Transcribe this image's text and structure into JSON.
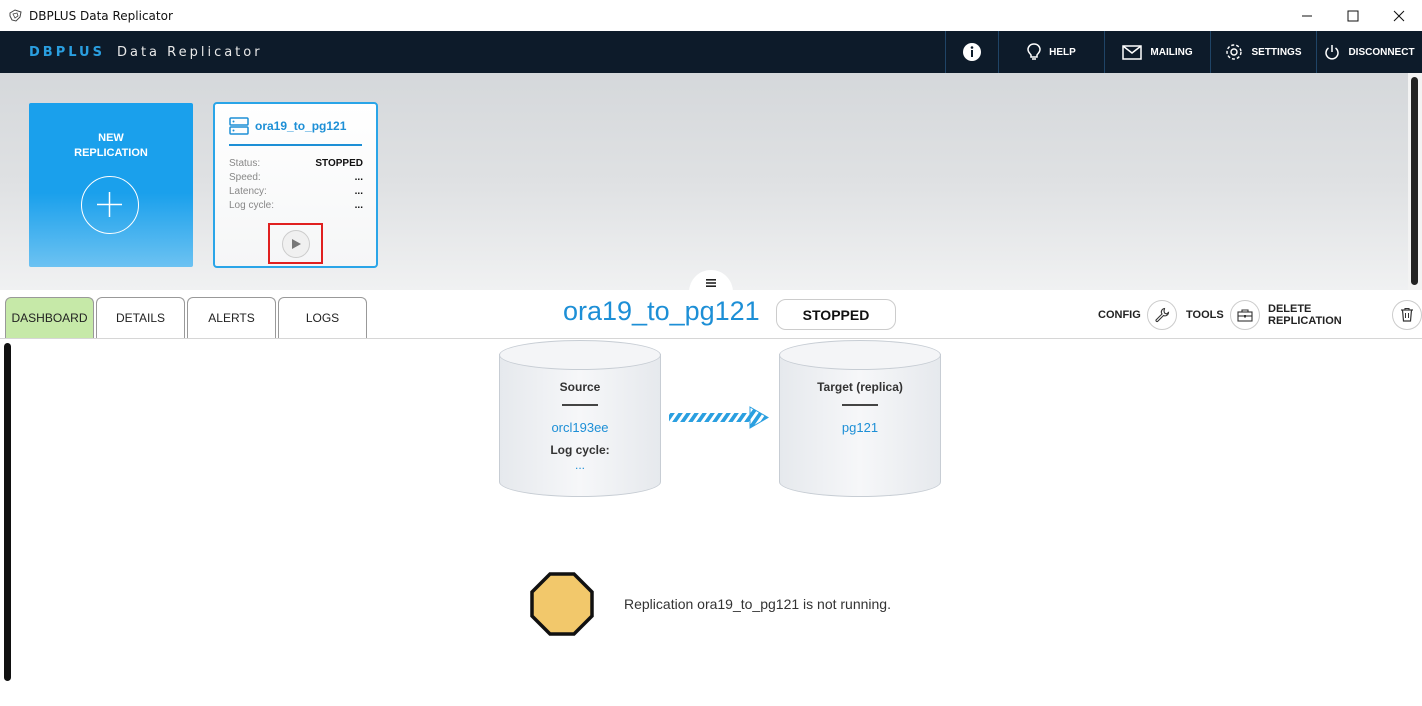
{
  "window": {
    "title": "DBPLUS Data Replicator"
  },
  "header": {
    "brand_primary": "DBPLUS",
    "brand_secondary": "Data Replicator",
    "nav": {
      "help": "HELP",
      "mailing": "MAILING",
      "settings": "SETTINGS",
      "disconnect": "DISCONNECT"
    }
  },
  "new_replication": {
    "line1": "NEW",
    "line2": "REPLICATION"
  },
  "replication_card": {
    "name": "ora19_to_pg121",
    "rows": [
      {
        "label": "Status:",
        "value": "STOPPED"
      },
      {
        "label": "Speed:",
        "value": "..."
      },
      {
        "label": "Latency:",
        "value": "..."
      },
      {
        "label": "Log cycle:",
        "value": "..."
      }
    ]
  },
  "tabs": [
    "DASHBOARD",
    "DETAILS",
    "ALERTS",
    "LOGS"
  ],
  "main": {
    "replication_name": "ora19_to_pg121",
    "status": "STOPPED",
    "actions": {
      "config": "CONFIG",
      "tools": "TOOLS",
      "delete": "DELETE REPLICATION"
    }
  },
  "source": {
    "title": "Source",
    "value": "orcl193ee",
    "log_cycle_label": "Log cycle:",
    "log_cycle_value": "..."
  },
  "target": {
    "title": "Target (replica)",
    "value": "pg121"
  },
  "message": "Replication ora19_to_pg121 is not running.",
  "colors": {
    "accent": "#1d8fd6",
    "header_bg": "#0d1b2a",
    "active_tab": "#c6e9a8",
    "warning": "#f2c86b",
    "highlight_box": "#e02020"
  }
}
